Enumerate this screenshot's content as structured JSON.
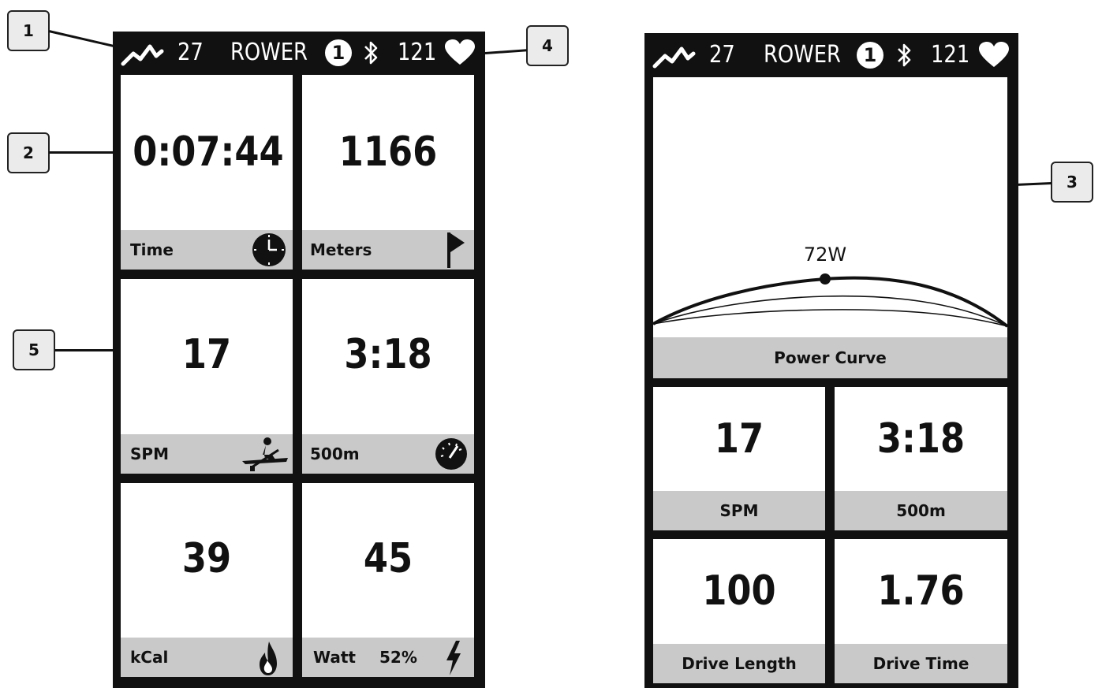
{
  "callouts": [
    "1",
    "2",
    "3",
    "4",
    "5"
  ],
  "status_bar": {
    "trend_value": "27",
    "mode_label": "ROWER",
    "device_number": "1",
    "heart_rate": "121",
    "icons": [
      "trend-line-icon",
      "bluetooth-icon",
      "heart-icon"
    ]
  },
  "screen1": {
    "tiles": [
      {
        "value": "0:07:44",
        "label": "Time",
        "icon": "clock-icon"
      },
      {
        "value": "1166",
        "label": "Meters",
        "icon": "flag-icon"
      },
      {
        "value": "17",
        "label": "SPM",
        "icon": "rower-icon"
      },
      {
        "value": "3:18",
        "label": "500m",
        "icon": "speedometer-icon"
      },
      {
        "value": "39",
        "label": "kCal",
        "icon": "flame-icon"
      },
      {
        "value": "45",
        "label": "Watt",
        "extra": "52%",
        "icon": "lightning-icon"
      }
    ]
  },
  "screen2": {
    "power_curve": {
      "peak_label": "72W",
      "label": "Power Curve"
    },
    "tiles": [
      {
        "value": "17",
        "label": "SPM"
      },
      {
        "value": "3:18",
        "label": "500m"
      },
      {
        "value": "100",
        "label": "Drive Length"
      },
      {
        "value": "1.76",
        "label": "Drive Time"
      }
    ]
  },
  "colors": {
    "frame": "#111111",
    "label_bar": "#c9c9c9",
    "tile": "#ffffff",
    "callout_bg": "#ebebeb"
  }
}
